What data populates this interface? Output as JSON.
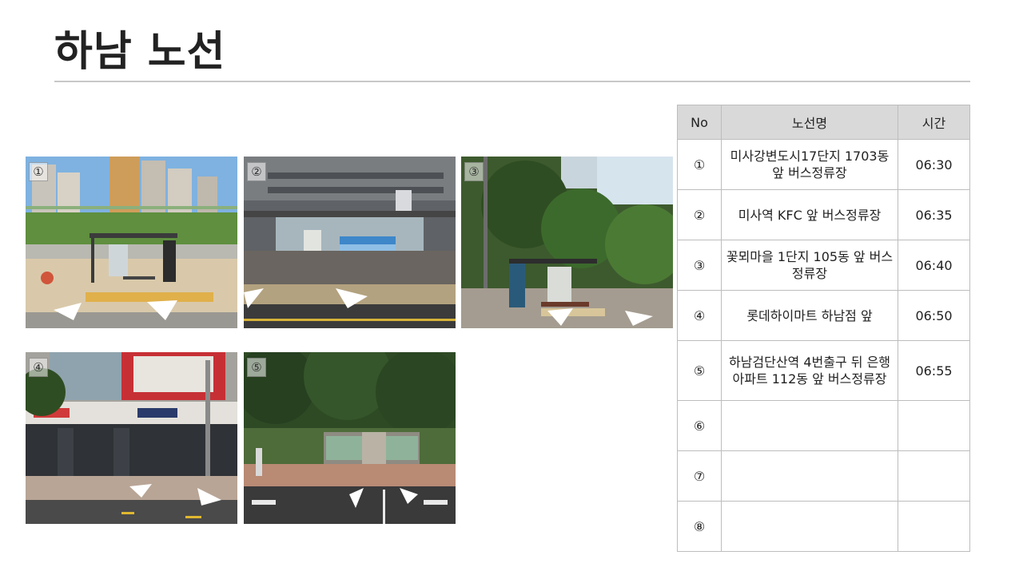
{
  "page": {
    "title": "하남 노선"
  },
  "photos": [
    {
      "label": "①"
    },
    {
      "label": "②"
    },
    {
      "label": "③"
    },
    {
      "label": "④"
    },
    {
      "label": "⑤"
    }
  ],
  "table": {
    "headers": {
      "no": "No",
      "route": "노선명",
      "time": "시간"
    },
    "rows": [
      {
        "no": "①",
        "route": "미사강변도시17단지 1703동 앞 버스정류장",
        "time": "06:30"
      },
      {
        "no": "②",
        "route": "미사역 KFC 앞 버스정류장",
        "time": "06:35"
      },
      {
        "no": "③",
        "route": "꽃뫼마을 1단지 105동 앞 버스정류장",
        "time": "06:40"
      },
      {
        "no": "④",
        "route": "롯데하이마트 하남점 앞",
        "time": "06:50"
      },
      {
        "no": "⑤",
        "route": "하남검단산역 4번출구 뒤 은행아파트 112동 앞 버스정류장",
        "time": "06:55"
      },
      {
        "no": "⑥",
        "route": "",
        "time": ""
      },
      {
        "no": "⑦",
        "route": "",
        "time": ""
      },
      {
        "no": "⑧",
        "route": "",
        "time": ""
      }
    ]
  }
}
